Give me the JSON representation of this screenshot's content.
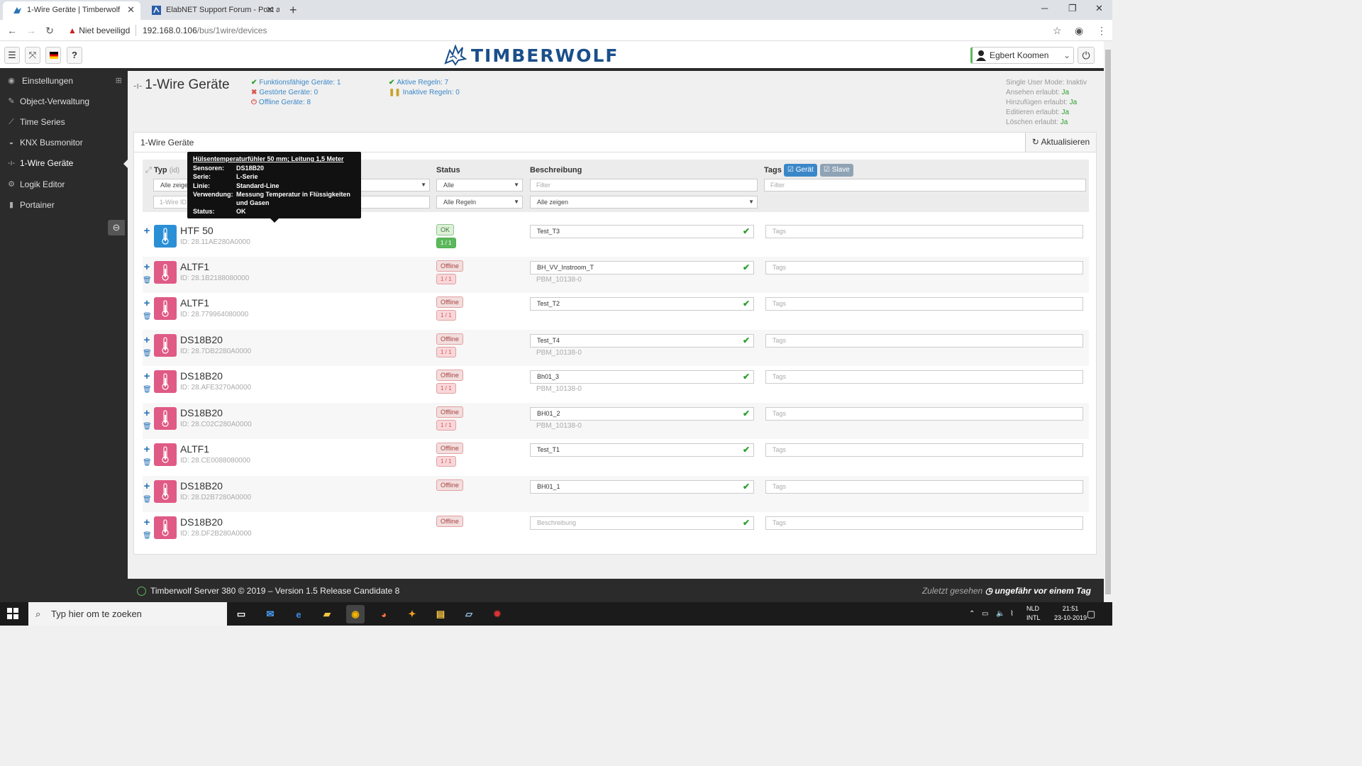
{
  "browser": {
    "tabs": [
      {
        "title": "1-Wire Geräte | Timberwolf",
        "active": true
      },
      {
        "title": "ElabNET Support Forum - Post a",
        "active": false
      }
    ],
    "new_tab": "+",
    "security_label": "Niet beveiligd",
    "url_host": "192.168.0.106",
    "url_path": "/bus/1wire/devices"
  },
  "header": {
    "logo_text": "TIMBERWOLF",
    "user": "Egbert Koomen",
    "colors": {
      "brand": "#1a4f8a",
      "sidebar": "#2b2b2b"
    }
  },
  "sidebar": {
    "items": [
      {
        "label": "Einstellungen",
        "icon": "dashboard-icon"
      },
      {
        "label": "Object-Verwaltung",
        "icon": "wrench-icon"
      },
      {
        "label": "Time Series",
        "icon": "chart-line-icon"
      },
      {
        "label": "KNX Busmonitor",
        "icon": "eye-icon"
      },
      {
        "label": "1-Wire Geräte",
        "icon": "onewire-icon",
        "active": true
      },
      {
        "label": "Logik Editor",
        "icon": "cogs-icon"
      },
      {
        "label": "Portainer",
        "icon": "docker-icon"
      }
    ],
    "expand_symbol": "⊞"
  },
  "page": {
    "title": "1-Wire Geräte",
    "stats_col1": [
      {
        "label": "Funktionsfähige Geräte: 1",
        "mark": "✔",
        "kind": "g"
      },
      {
        "label": "Gestörte Geräte: 0",
        "mark": "✖",
        "kind": "r"
      },
      {
        "label": "Offline Geräte: 8",
        "mark": "⏻",
        "kind": "r"
      }
    ],
    "stats_col2": [
      {
        "label": "Aktive Regeln: 7",
        "mark": "✔",
        "kind": "g"
      },
      {
        "label": "Inaktive Regeln: 0",
        "mark": "❚❚",
        "kind": "y"
      }
    ],
    "permissions": [
      {
        "label": "Single User Mode:",
        "value": "Inaktiv"
      },
      {
        "label": "Ansehen erlaubt:",
        "value": "Ja"
      },
      {
        "label": "Hinzufügen erlaubt:",
        "value": "Ja"
      },
      {
        "label": "Editieren erlaubt:",
        "value": "Ja"
      },
      {
        "label": "Löschen erlaubt:",
        "value": "Ja"
      }
    ]
  },
  "panel": {
    "title": "1-Wire Geräte",
    "refresh_label": "Aktualisieren",
    "headers": {
      "typ": "Typ",
      "typ_sub": "(id)",
      "status": "Status",
      "beschreibung": "Beschreibung",
      "tags": "Tags"
    },
    "tag_buttons": {
      "geraet": "Gerät",
      "slave": "Slave"
    },
    "filters": {
      "typ_select": "Alle zeigen",
      "id_placeholder": "1-Wire ID",
      "status_select": "Alle",
      "rules_select": "Alle Regeln",
      "desc_placeholder": "Filter",
      "desc_select": "Alle zeigen",
      "tags_placeholder": "Filter"
    },
    "tags_placeholder": "Tags"
  },
  "tooltip": {
    "title": "Hülsentemperaturfühler 50 mm; Leitung 1,5 Meter",
    "rows": [
      {
        "k": "Sensoren:",
        "v": "DS18B20"
      },
      {
        "k": "Serie:",
        "v": "L-Serie"
      },
      {
        "k": "Linie:",
        "v": "Standard-Line"
      },
      {
        "k": "Verwendung:",
        "v": "Messung Temperatur in Flüssigkeiten und Gasen"
      },
      {
        "k": "Status:",
        "v": "OK"
      }
    ]
  },
  "devices": [
    {
      "name": "HTF 50",
      "id": "ID: 28.11AE280A0000",
      "status": "OK",
      "rules": "1 / 1",
      "desc": "Test_T3",
      "desc_sub": "",
      "ok": true,
      "trash": false
    },
    {
      "name": "ALTF1",
      "id": "ID: 28.1B2188080000",
      "status": "Offline",
      "rules": "1 / 1",
      "desc": "BH_VV_Instroom_T",
      "desc_sub": "PBM_10138-0",
      "ok": false,
      "trash": true
    },
    {
      "name": "ALTF1",
      "id": "ID: 28.779964080000",
      "status": "Offline",
      "rules": "1 / 1",
      "desc": "Test_T2",
      "desc_sub": "",
      "ok": false,
      "trash": true
    },
    {
      "name": "DS18B20",
      "id": "ID: 28.7DB2280A0000",
      "status": "Offline",
      "rules": "1 / 1",
      "desc": "Test_T4",
      "desc_sub": "PBM_10138-0",
      "ok": false,
      "trash": true
    },
    {
      "name": "DS18B20",
      "id": "ID: 28.AFE3270A0000",
      "status": "Offline",
      "rules": "1 / 1",
      "desc": "Bh01_3",
      "desc_sub": "PBM_10138-0",
      "ok": false,
      "trash": true
    },
    {
      "name": "DS18B20",
      "id": "ID: 28.C02C280A0000",
      "status": "Offline",
      "rules": "1 / 1",
      "desc": "BH01_2",
      "desc_sub": "PBM_10138-0",
      "ok": false,
      "trash": true
    },
    {
      "name": "ALTF1",
      "id": "ID: 28.CE0088080000",
      "status": "Offline",
      "rules": "1 / 1",
      "desc": "Test_T1",
      "desc_sub": "",
      "ok": false,
      "trash": true
    },
    {
      "name": "DS18B20",
      "id": "ID: 28.D2B7280A0000",
      "status": "Offline",
      "rules": "",
      "desc": "BH01_1",
      "desc_sub": "",
      "ok": false,
      "trash": true
    },
    {
      "name": "DS18B20",
      "id": "ID: 28.DF2B280A0000",
      "status": "Offline",
      "rules": "",
      "desc": "Beschreibung",
      "desc_sub": "",
      "ok": false,
      "trash": true,
      "desc_placeholder": true
    }
  ],
  "footer": {
    "left": "Timberwolf Server 380 © 2019 – Version 1.5 Release Candidate 8",
    "right_label": "Zuletzt gesehen",
    "right_value": "ungefähr vor einem Tag"
  },
  "taskbar": {
    "search_placeholder": "Typ hier om te zoeken",
    "lang_1": "NLD",
    "lang_2": "INTL",
    "time": "21:51",
    "date": "23-10-2019"
  }
}
